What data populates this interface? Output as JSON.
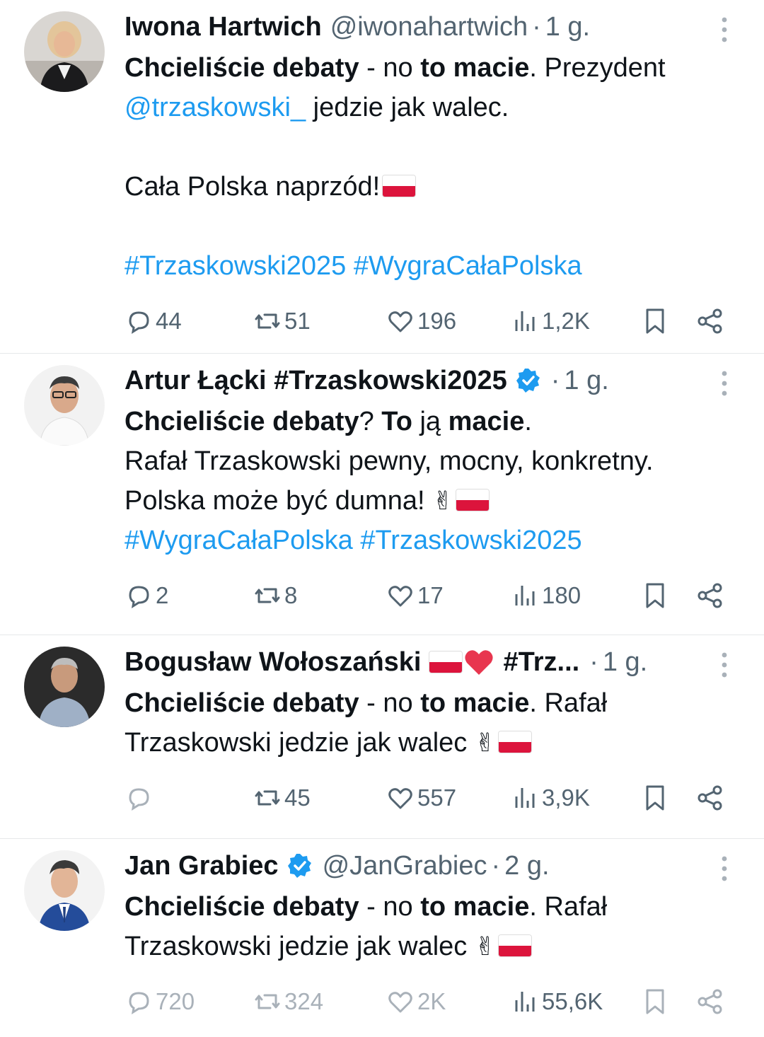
{
  "tweets": [
    {
      "name": "Iwona Hartwich",
      "handle": "@iwonahartwich",
      "dot": "·",
      "time": "1 g.",
      "text": {
        "bold1": "Chcieliście debaty",
        "t1": " - no ",
        "bold2": "to macie",
        "t2": ". Prezydent ",
        "mention": "@trzaskowski_",
        "t3": " jedzie jak walec.",
        "line2": "Cała Polska naprzód!",
        "hashtags": "#Trzaskowski2025 #WygraCałaPolska"
      },
      "replies": "44",
      "reposts": "51",
      "likes": "196",
      "views": "1,2K"
    },
    {
      "name": "Artur Łącki #Trzaskowski2025",
      "dot": "·",
      "time": "1 g.",
      "verified": true,
      "text": {
        "bold1": "Chcieliście debaty",
        "t1": "? ",
        "bold2": "To",
        "t2": " ją ",
        "bold3": "macie",
        "t3": ".",
        "line2": "Rafał Trzaskowski pewny, mocny, konkretny.",
        "line3": "Polska może być dumna! ",
        "hashtags": "#WygraCałaPolska #Trzaskowski2025"
      },
      "replies": "2",
      "reposts": "8",
      "likes": "17",
      "views": "180"
    },
    {
      "name": "Bogusław Wołoszański",
      "name_suffix": "#Trz...",
      "dot": "·",
      "time": "1 g.",
      "text": {
        "bold1": "Chcieliście debaty",
        "t1": " - no ",
        "bold2": "to macie",
        "t2": ". Rafał",
        "line2": "Trzaskowski jedzie jak walec "
      },
      "replies": "",
      "reposts": "45",
      "likes": "557",
      "views": "3,9K"
    },
    {
      "name": "Jan Grabiec",
      "handle": "@JanGrabiec",
      "dot": "·",
      "time": "2 g.",
      "verified": true,
      "text": {
        "bold1": "Chcieliście debaty",
        "t1": " - no ",
        "bold2": "to macie",
        "t2": ". Rafał",
        "line2": "Trzaskowski jedzie jak walec "
      },
      "replies": "720",
      "reposts": "324",
      "likes": "2K",
      "views": "55,6K"
    }
  ],
  "icons": {
    "reply": "speech-bubble-icon",
    "repost": "repost-arrows-icon",
    "like": "heart-icon",
    "views": "bar-chart-icon",
    "bookmark": "bookmark-icon",
    "share": "share-icon",
    "more": "vertical-dots-icon",
    "verified": "verified-badge-icon"
  },
  "colors": {
    "link": "#1d9bf0",
    "muted": "#536471",
    "text": "#0f1419",
    "verified": "#1d9bf0"
  }
}
